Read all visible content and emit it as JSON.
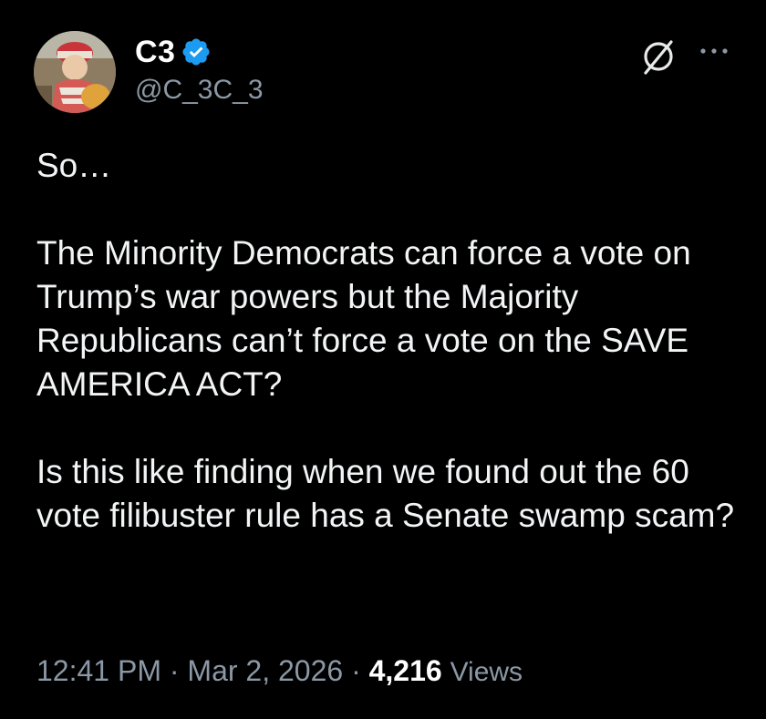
{
  "author": {
    "display_name": "C3",
    "handle": "@C_3C_3",
    "verified": true,
    "verified_color": "#1d9bf0"
  },
  "icons": {
    "verified": "verified-badge-icon",
    "grok": "grok-icon",
    "more": "more-options-icon"
  },
  "tweet": {
    "paragraphs": [
      "So…",
      "The Minority Democrats can force a vote on Trump’s war powers but the Majority Republicans can’t force a vote on the SAVE AMERICA ACT?",
      "Is this like finding when we found out the 60 vote filibuster rule has a Senate swamp scam?"
    ],
    "time": "12:41 PM",
    "date": "Mar 2, 2026",
    "separator": " · ",
    "views_count": "4,216",
    "views_label": "Views"
  },
  "colors": {
    "background": "#000000",
    "text": "#e7e9ea",
    "secondary": "#8b98a5"
  }
}
